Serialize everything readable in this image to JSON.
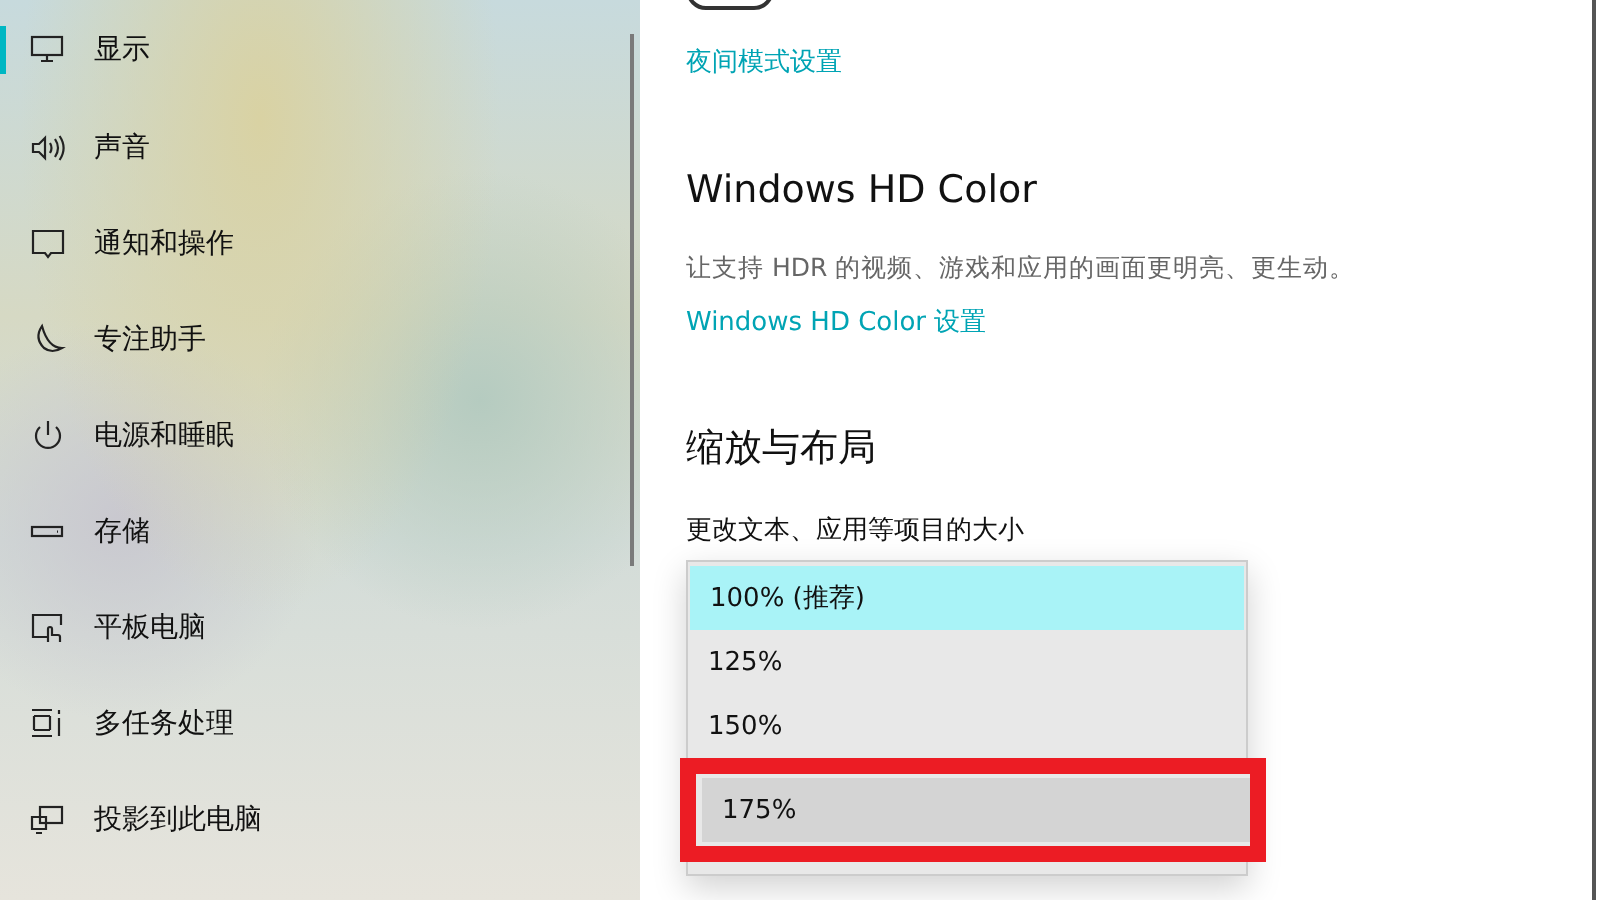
{
  "sidebar": {
    "items": [
      {
        "label": "显示",
        "selected": true
      },
      {
        "label": "声音",
        "selected": false
      },
      {
        "label": "通知和操作",
        "selected": false
      },
      {
        "label": "专注助手",
        "selected": false
      },
      {
        "label": "电源和睡眠",
        "selected": false
      },
      {
        "label": "存储",
        "selected": false
      },
      {
        "label": "平板电脑",
        "selected": false
      },
      {
        "label": "多任务处理",
        "selected": false
      },
      {
        "label": "投影到此电脑",
        "selected": false
      }
    ]
  },
  "main": {
    "night_toggle": {
      "on": false
    },
    "night_link": "夜间模式设置",
    "hd_heading": "Windows HD Color",
    "hd_description": "让支持 HDR 的视频、游戏和应用的画面更明亮、更生动。",
    "hd_link": "Windows HD Color 设置",
    "scale_heading": "缩放与布局",
    "scale_label": "更改文本、应用等项目的大小",
    "scale_options": [
      {
        "label": "100% (推荐)",
        "selected": true,
        "hovered": false,
        "outlined": false
      },
      {
        "label": "125%",
        "selected": false,
        "hovered": false,
        "outlined": false
      },
      {
        "label": "150%",
        "selected": false,
        "hovered": false,
        "outlined": false
      },
      {
        "label": "175%",
        "selected": false,
        "hovered": true,
        "outlined": true
      }
    ]
  }
}
